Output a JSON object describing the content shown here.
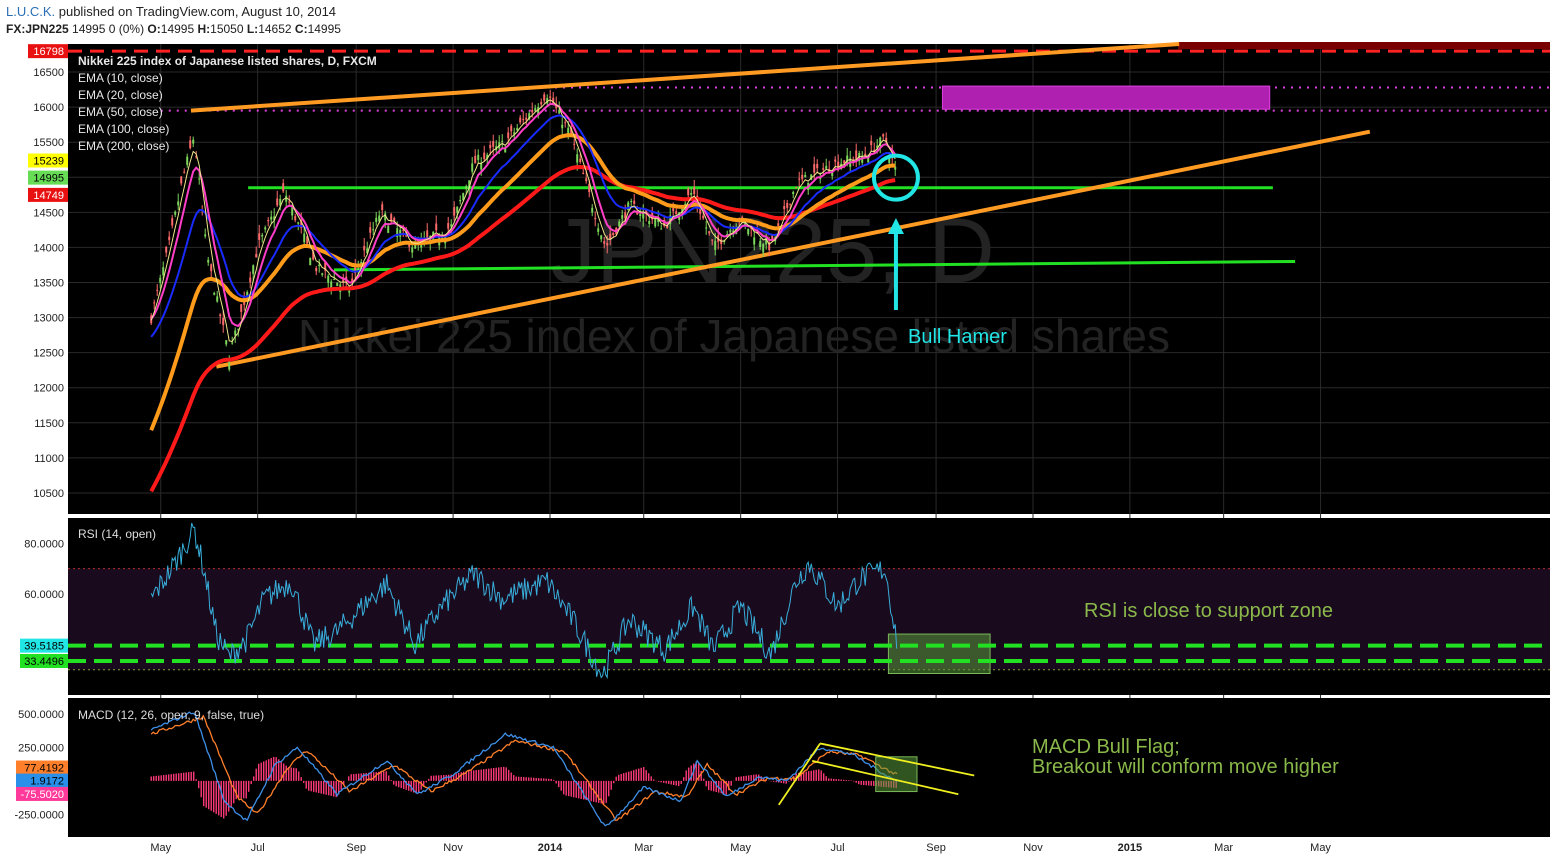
{
  "header": {
    "author": "L.U.C.K.",
    "published": " published on TradingView.com, August 10, 2014",
    "symbol": "FX:JPN225",
    "quote": " 14995 0 (0%) ",
    "o_label": "O:",
    "o": "14995",
    "h_label": " H:",
    "h": "15050",
    "l_label": " L:",
    "l": "14652",
    "c_label": " C:",
    "c": "14995"
  },
  "colors": {
    "background": "#000000",
    "grid": "#2a2a2a",
    "ema10": "#f0e68c",
    "ema20": "#ff3ec8",
    "ema50": "#1a2bff",
    "ema100": "#ff9b1a",
    "ema200": "#ff1a1a",
    "candle_up": "#7cd65a",
    "candle_down": "#ff6a6a",
    "rsi_line": "#38aeda",
    "macd_line": "#3e8fe8",
    "signal_line": "#ff7f2a",
    "histogram": "#ff3a7a",
    "support_green": "#22e022",
    "trend_orange": "#ff9a22",
    "resistance_red": "#ff2222",
    "magenta_dotted": "#e040e0",
    "annotation_cyan": "#22e6e6",
    "annotation_text_green": "#8ab84a",
    "flag_yellow": "#f0f020"
  },
  "chart_data": {
    "type": "candlestick",
    "title": "Nikkei 225 index of Japanese listed shares, D, FXCM",
    "watermark_symbol": "JPN225, D",
    "watermark_name": "Nikkei 225 index of Japanese listed shares",
    "legend": [
      "EMA (10, close)",
      "EMA (20, close)",
      "EMA (50, close)",
      "EMA (100, close)",
      "EMA (200, close)"
    ],
    "x_ticks": [
      "May",
      "Jul",
      "Sep",
      "Nov",
      "2014",
      "Mar",
      "May",
      "Jul",
      "Sep",
      "Nov",
      "2015",
      "Mar",
      "May"
    ],
    "y_ticks": [
      10500,
      11000,
      11500,
      12000,
      12500,
      13000,
      13500,
      14000,
      14500,
      15000,
      15500,
      16000,
      16500
    ],
    "ylim": [
      10200,
      16900
    ],
    "price_labels": {
      "top": "16798",
      "ema10": "15239",
      "last": "14995",
      "ema200": "14749"
    },
    "price_path": [
      [
        "2013-04-25",
        13000
      ],
      [
        "2013-05-06",
        14000
      ],
      [
        "2013-05-15",
        15000
      ],
      [
        "2013-05-22",
        15600
      ],
      [
        "2013-05-30",
        13900
      ],
      [
        "2013-06-13",
        12450
      ],
      [
        "2013-06-20",
        13000
      ],
      [
        "2013-07-01",
        14000
      ],
      [
        "2013-07-18",
        14800
      ],
      [
        "2013-08-07",
        13700
      ],
      [
        "2013-08-28",
        13400
      ],
      [
        "2013-09-16",
        14500
      ],
      [
        "2013-10-08",
        14000
      ],
      [
        "2013-10-31",
        14300
      ],
      [
        "2013-11-14",
        15200
      ],
      [
        "2013-12-04",
        15500
      ],
      [
        "2013-12-30",
        16200
      ],
      [
        "2014-01-14",
        15600
      ],
      [
        "2014-02-05",
        14000
      ],
      [
        "2014-02-20",
        14600
      ],
      [
        "2014-03-14",
        14300
      ],
      [
        "2014-04-01",
        14800
      ],
      [
        "2014-04-14",
        14000
      ],
      [
        "2014-04-30",
        14400
      ],
      [
        "2014-05-20",
        14000
      ],
      [
        "2014-06-05",
        14900
      ],
      [
        "2014-06-30",
        15200
      ],
      [
        "2014-07-17",
        15300
      ],
      [
        "2014-07-31",
        15550
      ],
      [
        "2014-08-08",
        14995
      ]
    ],
    "lines": {
      "resistance_red_dashed": 16798,
      "magenta_dotted": [
        16280,
        15950
      ],
      "magenta_zone": {
        "from": "2014-09-05",
        "to": "2015-03-30",
        "low": 15970,
        "high": 16300
      },
      "green_support": [
        {
          "from": "2013-06-25",
          "to": "2015-04-01",
          "value": 14850
        },
        {
          "from": "2013-08-18",
          "to": "2015-04-15",
          "y_from": 13680,
          "y_to": 13800
        }
      ],
      "orange_trend": [
        {
          "from": "2013-05-20",
          "to": "2015-02-01",
          "y_from": 15950,
          "y_to": 16900
        },
        {
          "from": "2013-06-05",
          "to": "2015-06-01",
          "y_from": 12300,
          "y_to": 15650
        }
      ]
    },
    "annotations": {
      "bull_hammer": "Bull Hamer",
      "rsi_note": "RSI is close to support zone",
      "macd_note_1": "MACD Bull Flag;",
      "macd_note_2": "Breakout will conform move higher"
    },
    "rsi": {
      "title": "RSI (14, open)",
      "y_ticks": [
        80,
        60
      ],
      "ylim": [
        20,
        90
      ],
      "band": [
        30,
        70
      ],
      "support_levels": [
        "39.5185",
        "33.4496"
      ],
      "path": [
        [
          "2013-04-25",
          58
        ],
        [
          "2013-05-10",
          72
        ],
        [
          "2013-05-22",
          86
        ],
        [
          "2013-05-28",
          70
        ],
        [
          "2013-06-05",
          44
        ],
        [
          "2013-06-13",
          35
        ],
        [
          "2013-06-24",
          42
        ],
        [
          "2013-07-05",
          58
        ],
        [
          "2013-07-22",
          65
        ],
        [
          "2013-08-05",
          40
        ],
        [
          "2013-08-20",
          45
        ],
        [
          "2013-09-05",
          55
        ],
        [
          "2013-09-20",
          64
        ],
        [
          "2013-10-08",
          40
        ],
        [
          "2013-10-25",
          55
        ],
        [
          "2013-11-14",
          68
        ],
        [
          "2013-12-02",
          58
        ],
        [
          "2013-12-30",
          65
        ],
        [
          "2014-01-15",
          50
        ],
        [
          "2014-02-03",
          28
        ],
        [
          "2014-02-20",
          50
        ],
        [
          "2014-03-14",
          38
        ],
        [
          "2014-04-01",
          55
        ],
        [
          "2014-04-14",
          38
        ],
        [
          "2014-05-01",
          55
        ],
        [
          "2014-05-20",
          36
        ],
        [
          "2014-06-05",
          65
        ],
        [
          "2014-06-13",
          72
        ],
        [
          "2014-07-01",
          55
        ],
        [
          "2014-07-15",
          66
        ],
        [
          "2014-07-31",
          70
        ],
        [
          "2014-08-08",
          39
        ]
      ]
    },
    "macd": {
      "title": "MACD (12, 26, open, 9, false, true)",
      "y_ticks": [
        500,
        250,
        -250
      ],
      "ylim": [
        -420,
        620
      ],
      "value_labels": [
        "77.4192",
        "1.9172",
        "-75.5020"
      ],
      "macd_path": [
        [
          "2013-04-25",
          380
        ],
        [
          "2013-05-22",
          520
        ],
        [
          "2013-06-10",
          -150
        ],
        [
          "2013-06-24",
          -300
        ],
        [
          "2013-07-12",
          120
        ],
        [
          "2013-07-26",
          250
        ],
        [
          "2013-08-20",
          -100
        ],
        [
          "2013-09-20",
          150
        ],
        [
          "2013-10-10",
          -100
        ],
        [
          "2013-11-01",
          50
        ],
        [
          "2013-12-04",
          350
        ],
        [
          "2014-01-03",
          250
        ],
        [
          "2014-02-05",
          -350
        ],
        [
          "2014-03-01",
          -50
        ],
        [
          "2014-03-24",
          -150
        ],
        [
          "2014-04-04",
          150
        ],
        [
          "2014-04-22",
          -120
        ],
        [
          "2014-05-12",
          30
        ],
        [
          "2014-05-30",
          0
        ],
        [
          "2014-06-20",
          250
        ],
        [
          "2014-07-10",
          200
        ],
        [
          "2014-08-08",
          -10
        ]
      ],
      "signal_path": [
        [
          "2013-04-25",
          350
        ],
        [
          "2013-05-28",
          480
        ],
        [
          "2013-06-18",
          -120
        ],
        [
          "2013-07-01",
          -250
        ],
        [
          "2013-07-20",
          100
        ],
        [
          "2013-08-01",
          230
        ],
        [
          "2013-08-28",
          -80
        ],
        [
          "2013-09-25",
          120
        ],
        [
          "2013-10-18",
          -80
        ],
        [
          "2013-11-08",
          50
        ],
        [
          "2013-12-10",
          300
        ],
        [
          "2014-01-10",
          220
        ],
        [
          "2014-02-12",
          -300
        ],
        [
          "2014-03-08",
          -80
        ],
        [
          "2014-03-28",
          -120
        ],
        [
          "2014-04-10",
          120
        ],
        [
          "2014-04-28",
          -100
        ],
        [
          "2014-05-18",
          20
        ],
        [
          "2014-06-05",
          20
        ],
        [
          "2014-06-25",
          220
        ],
        [
          "2014-07-15",
          190
        ],
        [
          "2014-08-08",
          40
        ]
      ]
    }
  }
}
